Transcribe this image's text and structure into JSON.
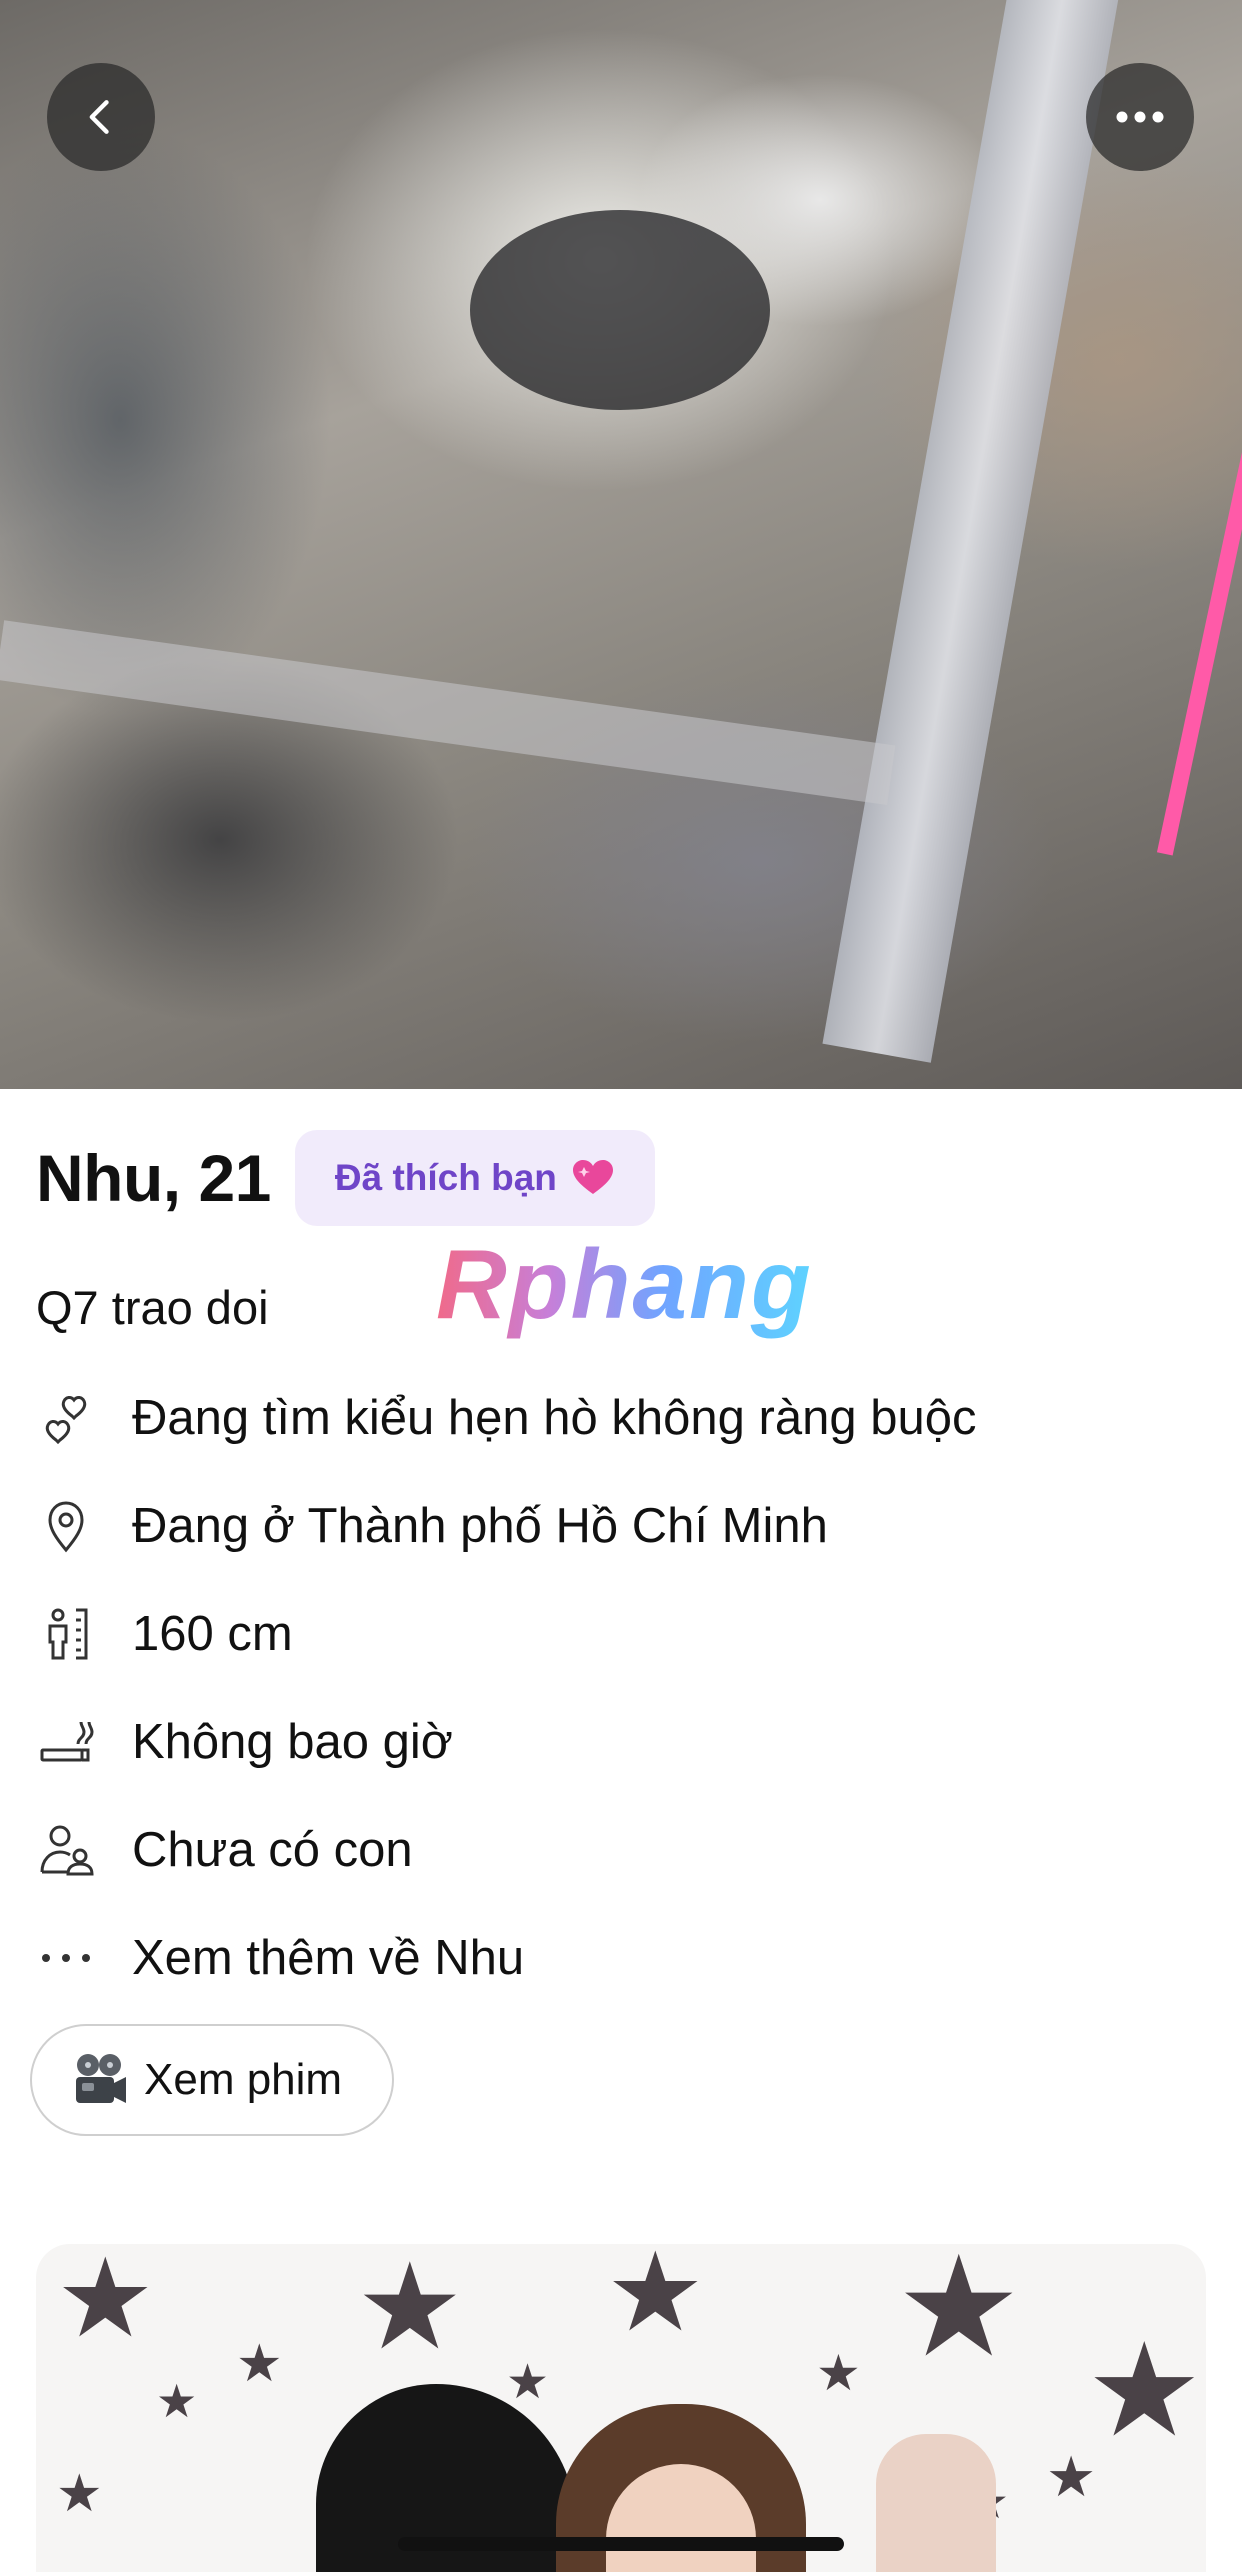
{
  "header": {
    "back_icon": "chevron-left-icon",
    "more_icon": "more-horizontal-icon"
  },
  "profile": {
    "name_age": "Nhu, 21",
    "liked_badge": "Đã thích bạn",
    "liked_badge_icon": "sparkling-heart-icon",
    "tagline": "Q7 trao doi"
  },
  "watermark": "Rphang",
  "details": [
    {
      "icon": "hearts-outline-icon",
      "label": "Đang tìm kiểu hẹn hò không ràng buộc"
    },
    {
      "icon": "location-pin-icon",
      "label": "Đang ở Thành phố Hồ Chí Minh"
    },
    {
      "icon": "height-ruler-icon",
      "label": "160 cm"
    },
    {
      "icon": "smoking-icon",
      "label": "Không bao giờ"
    },
    {
      "icon": "children-icon",
      "label": "Chưa có con"
    },
    {
      "icon": "ellipsis-icon",
      "label": "Xem thêm về Nhu"
    }
  ],
  "interest_chip": {
    "icon": "film-projector-icon",
    "label": "Xem phim"
  },
  "colors": {
    "badge_bg": "#f1ebfb",
    "badge_text": "#6f45c8",
    "text": "#111111"
  }
}
